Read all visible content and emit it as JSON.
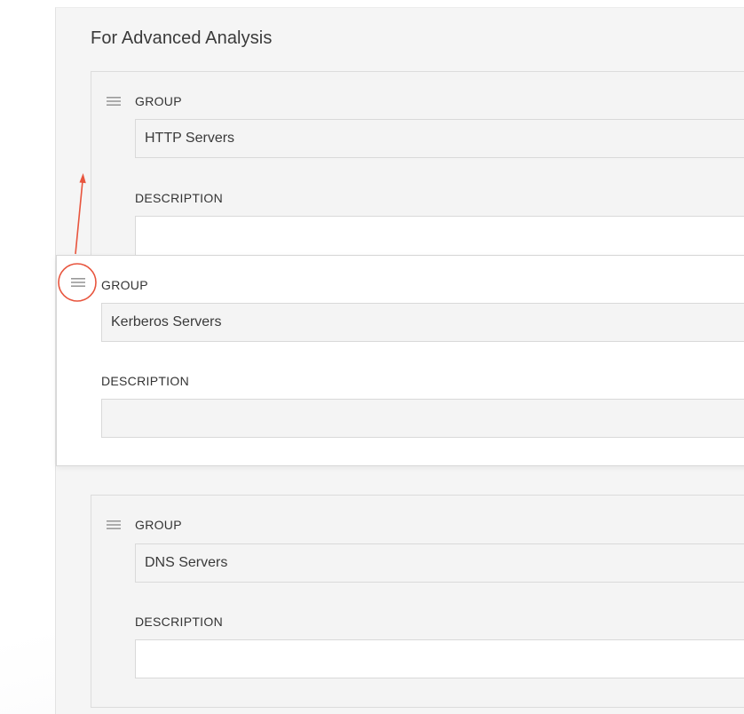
{
  "section": {
    "title": "For Advanced Analysis"
  },
  "groups": [
    {
      "group_label": "GROUP",
      "group_value": "HTTP Servers",
      "description_label": "DESCRIPTION",
      "description_value": ""
    },
    {
      "group_label": "GROUP",
      "group_value": "Kerberos Servers",
      "description_label": "DESCRIPTION",
      "description_value": "",
      "state": "dragging"
    },
    {
      "group_label": "GROUP",
      "group_value": "DNS Servers",
      "description_label": "DESCRIPTION",
      "description_value": ""
    }
  ],
  "icons": {
    "drag_handle": "drag-handle-icon",
    "annotation": "red-circle-and-arrow"
  },
  "colors": {
    "annotation_red": "#e8553e",
    "handle_gray": "#9a9a9a",
    "panel_bg": "#f5f5f5",
    "card_border": "#dcdcdc"
  }
}
